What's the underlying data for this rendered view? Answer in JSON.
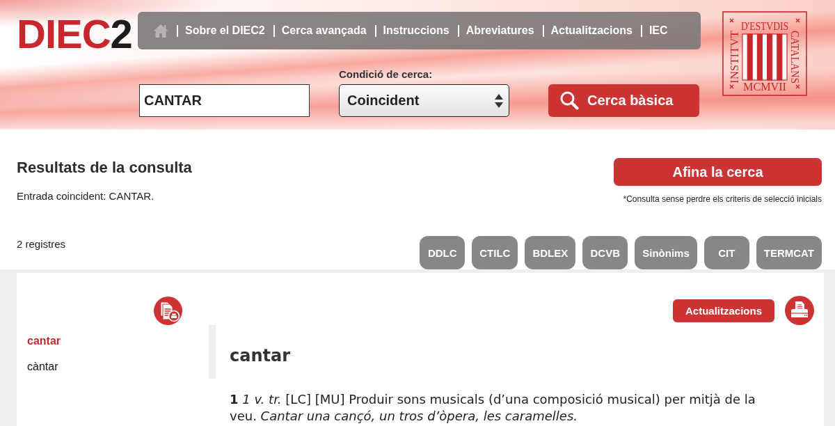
{
  "header": {
    "logo": {
      "main": "DIEC",
      "accent": "2"
    },
    "nav": [
      "Sobre el DIEC2",
      "Cerca avançada",
      "Instruccions",
      "Abreviatures",
      "Actualitzacions",
      "IEC"
    ],
    "search": {
      "value": "CANTAR",
      "condition_label": "Condició de cerca:",
      "condition": "Coincident",
      "button": "Cerca bàsica"
    },
    "seal": {
      "top": "D'ESTVDIS",
      "left": "INSTITVT",
      "right": "CATALANS",
      "bottom": "MCMVII"
    }
  },
  "results": {
    "title": "Resultats de la consulta",
    "summary": "Entrada coincident: CANTAR.",
    "refine_button": "Afina la cerca",
    "refine_note": "*Consulta sense perdre els criteris de selecció inicials",
    "count": "2 registres",
    "sources": [
      "DDLC",
      "CTILC",
      "BDLEX",
      "DCVB",
      "Sinònims",
      "CIT",
      "TERMCAT"
    ]
  },
  "entry": {
    "sidebar": [
      {
        "label": "cantar",
        "selected": true
      },
      {
        "label": "càntar",
        "selected": false
      }
    ],
    "updates_button": "Actualitzacions",
    "headword": "cantar",
    "definition": "**1** *1 v. tr.* [LC] [MU] Produir sons musicals (d’una composició musical) per mitjà de la veu. *Cantar una cançó, un tros d’òpera, les caramelles.*"
  }
}
